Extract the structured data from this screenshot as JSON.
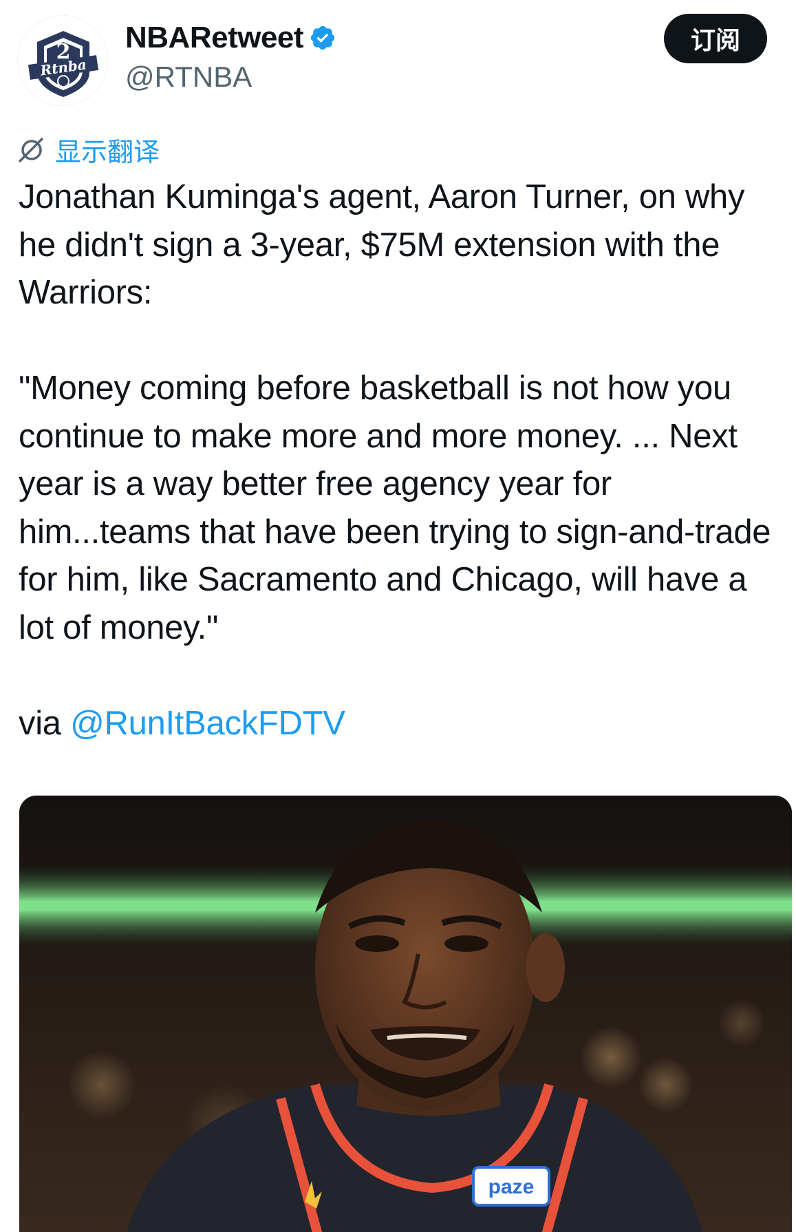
{
  "account": {
    "display_name": "NBARetweet",
    "handle": "@RTNBA",
    "verified": true,
    "avatar_text": "Rtnba"
  },
  "subscribe_button": {
    "label": "订阅"
  },
  "translate": {
    "label": "显示翻译",
    "icon": "translate-icon"
  },
  "tweet": {
    "paragraph_1": "Jonathan Kuminga's agent, Aaron Turner, on why he didn't sign a 3-year, $75M extension with the Warriors:",
    "paragraph_2": "\"Money coming before basketball is not how you continue to make more and more money. ... Next year is a way better free agency year for him...teams that have been trying to sign-and-trade for him, like Sacramento and Chicago, will have a lot of money.\"",
    "via_prefix": "via ",
    "via_mention": "@RunItBackFDTV"
  },
  "media": {
    "jersey_sponsor": "paze"
  },
  "colors": {
    "link": "#1d9bf0",
    "text": "#0f1419",
    "secondary": "#536471",
    "button_bg": "#0f1419"
  }
}
